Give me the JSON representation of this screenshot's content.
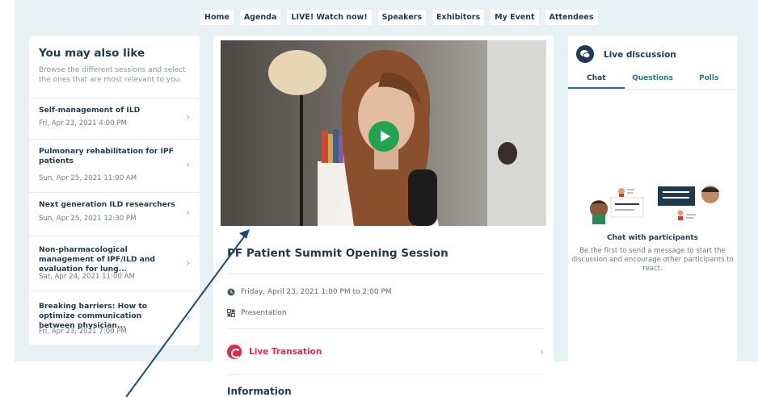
{
  "nav": {
    "items": [
      "Home",
      "Agenda",
      "LIVE! Watch now!",
      "Speakers",
      "Exhibitors",
      "My Event",
      "Attendees"
    ]
  },
  "left": {
    "title": "You may also like",
    "subtitle": "Browse the different sessions and select the ones that are most relevant to you.",
    "sessions": [
      {
        "title": "Self-management of ILD",
        "date": "Fri, Apr 23, 2021 4:00 PM"
      },
      {
        "title": "Pulmonary rehabilitation for IPF patients",
        "date": "Sun, Apr 25, 2021 11:00 AM"
      },
      {
        "title": "Next generation ILD researchers",
        "date": "Sun, Apr 25, 2021 12:30 PM"
      },
      {
        "title": "Non-pharmacological management of IPF/ILD and evaluation for lung...",
        "date": "Sat, Apr 24, 2021 11:00 AM"
      },
      {
        "title": "Breaking barriers: How to optimize communication between physician...",
        "date": "Fri, Apr 23, 2021 7:00 PM"
      }
    ]
  },
  "main": {
    "session_title": "PF Patient Summit Opening Session",
    "datetime": "Friday, April 23, 2021 1:00 PM to 2:00 PM",
    "type": "Presentation",
    "live_label": "Live Transation",
    "info_title": "Information"
  },
  "discussion": {
    "title": "Live discussion",
    "tabs": [
      "Chat",
      "Questions",
      "Polls"
    ],
    "empty_title": "Chat with participants",
    "empty_text": "Be the first to send a message to start the discussion and encourage other participants to react."
  },
  "colors": {
    "accent_green": "#21a353",
    "live_red": "#e02a49",
    "navy": "#1f3a4d",
    "background": "#e6f1f4",
    "annotation_arrow": "#1e4a73"
  }
}
